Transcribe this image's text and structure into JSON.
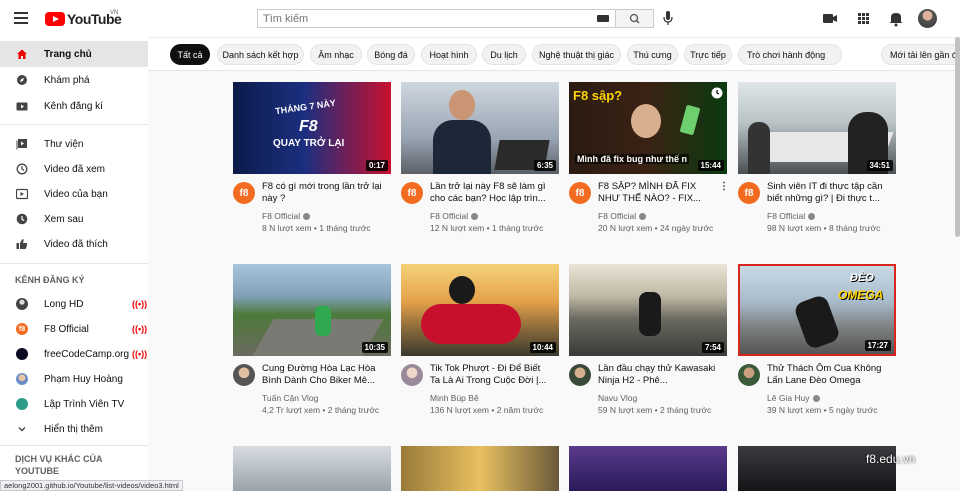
{
  "header": {
    "logo_text": "YouTube",
    "country_code": "VN",
    "search_placeholder": "Tìm kiếm"
  },
  "sidebar": {
    "main": [
      {
        "label": "Trang chủ",
        "icon": "home-icon",
        "active": true
      },
      {
        "label": "Khám phá",
        "icon": "explore-icon"
      },
      {
        "label": "Kênh đăng kí",
        "icon": "subscriptions-icon"
      }
    ],
    "library": [
      {
        "label": "Thư viện",
        "icon": "library-icon"
      },
      {
        "label": "Video đã xem",
        "icon": "history-icon"
      },
      {
        "label": "Video của bạn",
        "icon": "your-videos-icon"
      },
      {
        "label": "Xem sau",
        "icon": "watch-later-icon"
      },
      {
        "label": "Video đã thích",
        "icon": "liked-icon"
      }
    ],
    "subs_title": "KÊNH ĐĂNG KÝ",
    "subs": [
      {
        "label": "Long HD",
        "live": true,
        "color": "#555555"
      },
      {
        "label": "F8 Official",
        "live": true,
        "color": "#f26b21"
      },
      {
        "label": "freeCodeCamp.org",
        "live": true,
        "color": "#0a0a23"
      },
      {
        "label": "Phạm Huy Hoàng",
        "live": false,
        "color": "#6a8fc7"
      },
      {
        "label": "Lập Trình Viên TV",
        "live": false,
        "color": "#2d9d8a"
      }
    ],
    "show_more": "Hiển thị thêm",
    "more_services_title": "DỊCH VỤ KHÁC CỦA YOUTUBE"
  },
  "chips": [
    "Tất cả",
    "Danh sách kết hợp",
    "Âm nhạc",
    "Bóng đá",
    "Hoạt hình",
    "Du lịch",
    "Nghệ thuật thị giác",
    "Thú cưng",
    "Trực tiếp",
    "Trò chơi hành động",
    "Mới tải lên gần đây"
  ],
  "videos": [
    {
      "title": "F8 có gì mới trong lần trở lại này ?",
      "channel": "F8 Official",
      "views": "8 N lượt xem",
      "age": "1 tháng trước",
      "duration": "0:17"
    },
    {
      "title": "Lần trở lại này F8 sẽ làm gì cho các bạn? Học lập trìn...",
      "channel": "F8 Official",
      "views": "12 N lượt xem",
      "age": "1 tháng trước",
      "duration": "6:35"
    },
    {
      "title": "F8 SẬP? MÌNH ĐÃ FIX NHƯ THẾ NÀO? - FIX...",
      "channel": "F8 Official",
      "views": "20 N lượt xem",
      "age": "24 ngày trước",
      "duration": "15:44"
    },
    {
      "title": "Sinh viên IT đi thực tập cần biết những gì? | Đi thực t...",
      "channel": "F8 Official",
      "views": "98 N lượt xem",
      "age": "8 tháng trước",
      "duration": "34:51"
    },
    {
      "title": "Cung Đường Hòa Lạc Hòa Bình Dành Cho Biker Mê...",
      "channel": "Tuấn Cận Vlog",
      "views": "4,2 Tr lượt xem",
      "age": "2 tháng trước",
      "duration": "10:35"
    },
    {
      "title": "Tik Tok Phượt - Đi Để Biết Ta Là Ai Trong Cuộc Đời |...",
      "channel": "Minh Búp Bê",
      "views": "136 N lượt xem",
      "age": "2 năm trước",
      "duration": "10:44"
    },
    {
      "title": "Lần đầu chạy thử Kawasaki Ninja H2 - Phê...",
      "channel": "Navu Vlog",
      "views": "59 N lượt xem",
      "age": "2 tháng trước",
      "duration": "7:54"
    },
    {
      "title": "Thử Thách Ôm Cua Không Lấn Lane Đèo Omega",
      "channel": "Lê Gia Huy",
      "views": "39 N lượt xem",
      "age": "5 ngày trước",
      "duration": "17:27"
    }
  ],
  "thumb_texts": {
    "v1_top": "THÁNG 7 NÀY",
    "v1_mid": "F8",
    "v1_bot": "QUAY TRỞ LẠI",
    "v3_top": "F8 sập?",
    "v3_bot": "Mình đã fix bug như thế n",
    "v8_word1": "ĐÈO",
    "v8_word2": "OMEGA"
  },
  "status_url": "aelong2001.github.io/Youtube/list-videos/video3.html",
  "watermark": "f8.edu.vn"
}
